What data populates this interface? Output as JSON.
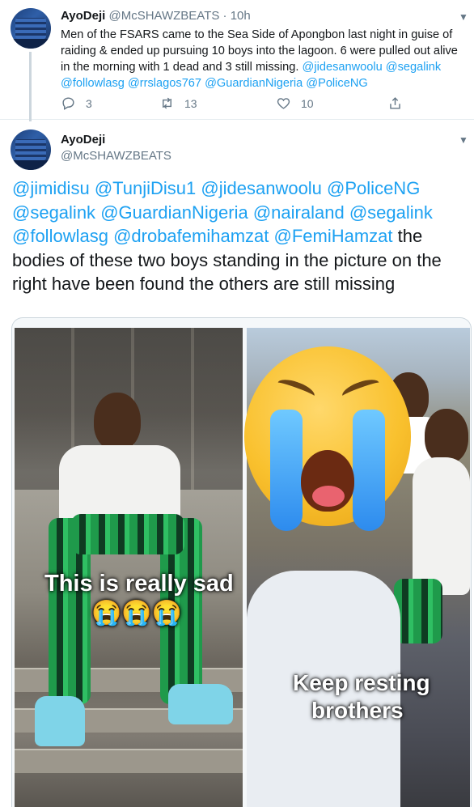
{
  "tweet1": {
    "name": "AyoDeji",
    "handle": "@McSHAWZBEATS",
    "separator": "·",
    "time": "10h",
    "text_plain": "Men of the FSARS came to the Sea Side of Apongbon last night in guise of raiding & ended up pursuing 10 boys into the lagoon. 6 were pulled out alive in the morning with 1 dead and 3 still missing.",
    "mentions": [
      "@jidesanwoolu",
      "@segalink",
      "@followlasg",
      "@rrslagos767",
      "@GuardianNigeria",
      "@PoliceNG"
    ],
    "counts": {
      "replies": "3",
      "retweets": "13",
      "likes": "10"
    }
  },
  "tweet2": {
    "name": "AyoDeji",
    "handle": "@McSHAWZBEATS",
    "mentions": [
      "@jimidisu",
      "@TunjiDisu1",
      "@jidesanwoolu",
      "@PoliceNG",
      "@segalink",
      "@GuardianNigeria",
      "@nairaland",
      "@segalink",
      "@followlasg",
      "@drobafemihamzat",
      "@FemiHamzat"
    ],
    "text_plain": "the bodies of these two boys standing in the picture on the right have been found the others are still missing"
  },
  "media": {
    "overlay_left": "This is really  sad",
    "overlay_left_emojis": "😭😭😭",
    "overlay_right_line1": "Keep resting",
    "overlay_right_line2": "brothers"
  },
  "icons": {
    "reply": "reply-icon",
    "retweet": "retweet-icon",
    "like": "heart-icon",
    "share": "share-icon",
    "more": "chevron-down-icon"
  },
  "colors": {
    "accent": "#1da1f2",
    "secondary": "#657786",
    "text": "#14171a"
  }
}
